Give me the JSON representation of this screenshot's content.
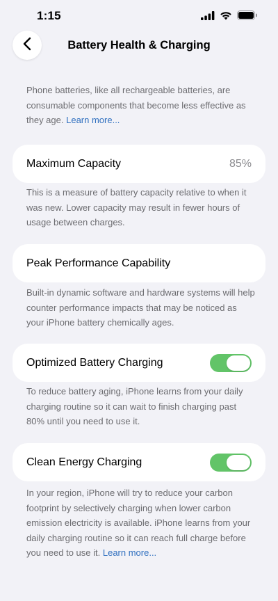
{
  "status_bar": {
    "time": "1:15"
  },
  "nav": {
    "title": "Battery Health & Charging"
  },
  "intro": {
    "text": "Phone batteries, like all rechargeable batteries, are consumable components that become less effective as they age. ",
    "link": "Learn more..."
  },
  "max_capacity": {
    "label": "Maximum Capacity",
    "value": "85%",
    "description": "This is a measure of battery capacity relative to when it was new. Lower capacity may result in fewer hours of usage between charges."
  },
  "peak_performance": {
    "label": "Peak Performance Capability",
    "description": "Built-in dynamic software and hardware systems will help counter performance impacts that may be noticed as your iPhone battery chemically ages."
  },
  "optimized_charging": {
    "label": "Optimized Battery Charging",
    "enabled": true,
    "description": "To reduce battery aging, iPhone learns from your daily charging routine so it can wait to finish charging past 80% until you need to use it."
  },
  "clean_energy": {
    "label": "Clean Energy Charging",
    "enabled": true,
    "description": "In your region, iPhone will try to reduce your carbon footprint by selectively charging when lower carbon emission electricity is available. iPhone learns from your daily charging routine so it can reach full charge before you need to use it. ",
    "link": "Learn more..."
  },
  "colors": {
    "background": "#f2f2f7",
    "toggle_on": "#62c468",
    "link": "#2f6fbf",
    "secondary_text": "#6c6c70"
  },
  "icons": [
    "cellular-signal-icon",
    "wifi-icon",
    "battery-icon",
    "chevron-left-icon"
  ]
}
